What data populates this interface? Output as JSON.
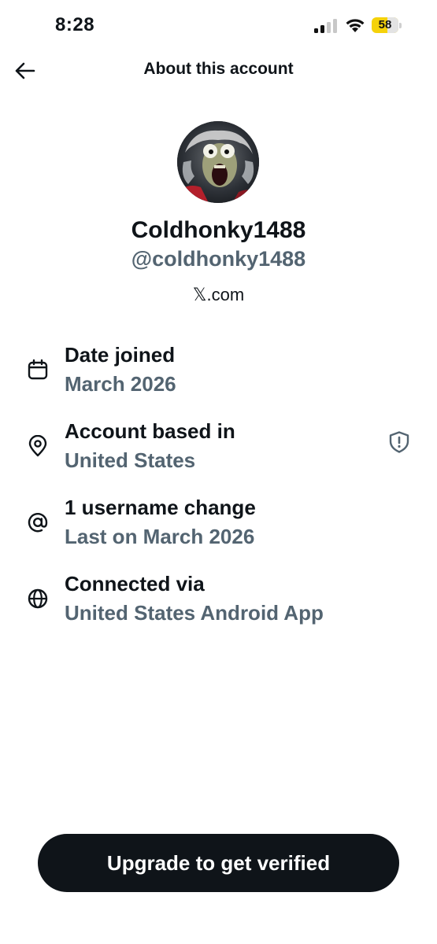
{
  "status_bar": {
    "time": "8:28",
    "battery_level": "58",
    "battery_fraction": 0.58,
    "signal_bars_active": 2,
    "signal_bars_total": 4,
    "icons": [
      "signal-icon",
      "wifi-icon",
      "battery-icon"
    ]
  },
  "header": {
    "back_icon": "arrow-left-icon",
    "title": "About this account"
  },
  "profile": {
    "display_name": "Coldhonky1488",
    "handle": "@coldhonky1488",
    "site": "𝕏.com"
  },
  "info_rows": [
    {
      "icon": "calendar-icon",
      "title": "Date joined",
      "value": "March 2026"
    },
    {
      "icon": "location-pin-icon",
      "title": "Account based in",
      "value": "United States",
      "action_icon": "shield-alert-icon"
    },
    {
      "icon": "at-sign-icon",
      "title": "1 username change",
      "value": "Last on March 2026"
    },
    {
      "icon": "globe-icon",
      "title": "Connected via",
      "value": "United States Android App"
    }
  ],
  "footer": {
    "upgrade_label": "Upgrade to get verified"
  },
  "colors": {
    "text_primary": "#0f1419",
    "text_secondary": "#536471",
    "button_bg": "#0f1419",
    "battery_fill": "#f5d20a"
  }
}
